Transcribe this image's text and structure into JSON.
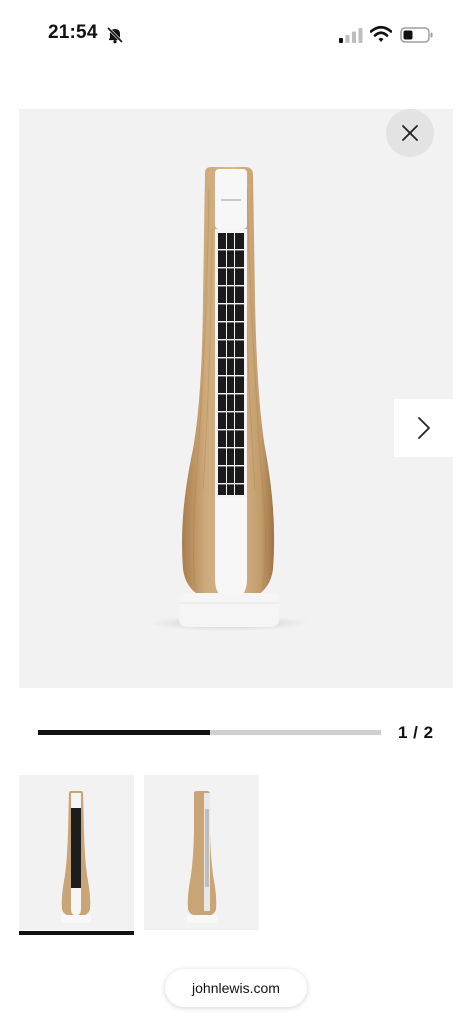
{
  "status_bar": {
    "time": "21:54",
    "icons": [
      "bell-slash-icon",
      "signal-icon",
      "wifi-icon",
      "battery-icon"
    ]
  },
  "viewer": {
    "product": "tower fan (wood-effect finish)",
    "close_icon": "close-icon",
    "next_icon": "chevron-right-icon",
    "progress_fraction": 0.5,
    "page_counter": "1 / 2"
  },
  "thumbnails": [
    {
      "name": "front view",
      "selected": true
    },
    {
      "name": "angled view",
      "selected": false
    }
  ],
  "browser": {
    "url": "johnlewis.com"
  },
  "colors": {
    "wood": "#c9a477",
    "wood_dark": "#a97e4d",
    "background": "#f2f2f2",
    "accent": "#111111"
  }
}
